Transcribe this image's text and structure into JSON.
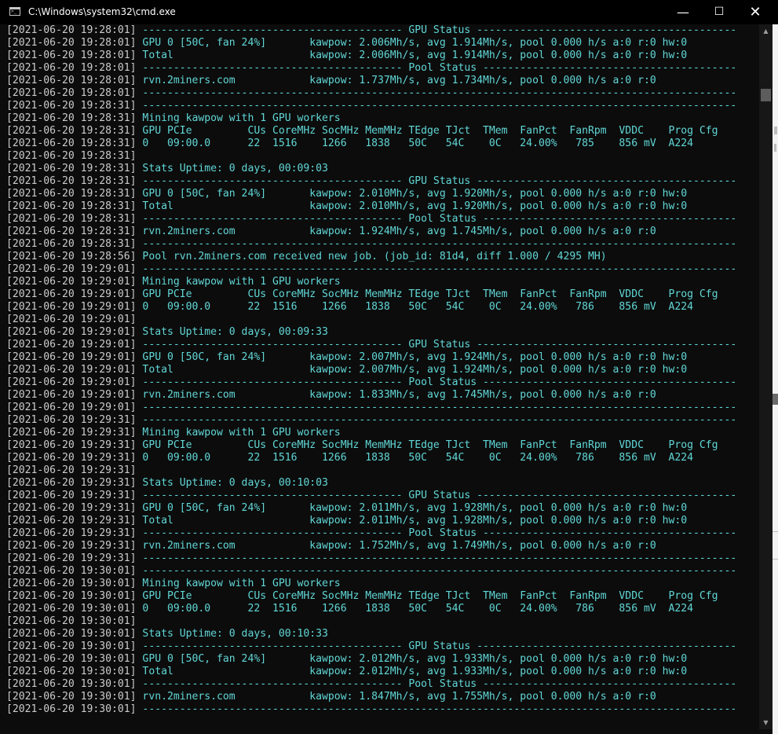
{
  "window": {
    "title": "C:\\Windows\\system32\\cmd.exe",
    "buttons": {
      "minimize": "—",
      "maximize": "☐",
      "close": "✕"
    }
  },
  "console": {
    "lines": [
      {
        "ts": "[2021-06-20 19:28:01]",
        "msg": " ------------------------------------------ GPU Status ------------------------------------------"
      },
      {
        "ts": "[2021-06-20 19:28:01]",
        "msg": " GPU 0 [50C, fan 24%]       kawpow: 2.006Mh/s, avg 1.914Mh/s, pool 0.000 h/s a:0 r:0 hw:0"
      },
      {
        "ts": "[2021-06-20 19:28:01]",
        "msg": " Total                      kawpow: 2.006Mh/s, avg 1.914Mh/s, pool 0.000 h/s a:0 r:0 hw:0"
      },
      {
        "ts": "[2021-06-20 19:28:01]",
        "msg": " ------------------------------------------ Pool Status -----------------------------------------"
      },
      {
        "ts": "[2021-06-20 19:28:01]",
        "msg": " rvn.2miners.com            kawpow: 1.737Mh/s, avg 1.734Mh/s, pool 0.000 h/s a:0 r:0"
      },
      {
        "ts": "[2021-06-20 19:28:01]",
        "msg": " ------------------------------------------------------------------------------------------------"
      },
      {
        "ts": "[2021-06-20 19:28:31]",
        "msg": " ------------------------------------------------------------------------------------------------"
      },
      {
        "ts": "[2021-06-20 19:28:31]",
        "msg": " Mining kawpow with 1 GPU workers"
      },
      {
        "ts": "[2021-06-20 19:28:31]",
        "msg": " GPU PCIe         CUs CoreMHz SocMHz MemMHz TEdge TJct  TMem  FanPct  FanRpm  VDDC    Prog Cfg"
      },
      {
        "ts": "[2021-06-20 19:28:31]",
        "msg": " 0   09:00.0      22  1516    1266   1838   50C   54C    0C   24.00%   785    856 mV  A224"
      },
      {
        "ts": "[2021-06-20 19:28:31]",
        "msg": ""
      },
      {
        "ts": "[2021-06-20 19:28:31]",
        "msg": " Stats Uptime: 0 days, 00:09:03"
      },
      {
        "ts": "[2021-06-20 19:28:31]",
        "msg": " ------------------------------------------ GPU Status ------------------------------------------"
      },
      {
        "ts": "[2021-06-20 19:28:31]",
        "msg": " GPU 0 [50C, fan 24%]       kawpow: 2.010Mh/s, avg 1.920Mh/s, pool 0.000 h/s a:0 r:0 hw:0"
      },
      {
        "ts": "[2021-06-20 19:28:31]",
        "msg": " Total                      kawpow: 2.010Mh/s, avg 1.920Mh/s, pool 0.000 h/s a:0 r:0 hw:0"
      },
      {
        "ts": "[2021-06-20 19:28:31]",
        "msg": " ------------------------------------------ Pool Status -----------------------------------------"
      },
      {
        "ts": "[2021-06-20 19:28:31]",
        "msg": " rvn.2miners.com            kawpow: 1.924Mh/s, avg 1.745Mh/s, pool 0.000 h/s a:0 r:0"
      },
      {
        "ts": "[2021-06-20 19:28:31]",
        "msg": " ------------------------------------------------------------------------------------------------"
      },
      {
        "ts": "[2021-06-20 19:28:56]",
        "msg": " Pool rvn.2miners.com received new job. (job_id: 81d4, diff 1.000 / 4295 MH)"
      },
      {
        "ts": "[2021-06-20 19:29:01]",
        "msg": " ------------------------------------------------------------------------------------------------"
      },
      {
        "ts": "[2021-06-20 19:29:01]",
        "msg": " Mining kawpow with 1 GPU workers"
      },
      {
        "ts": "[2021-06-20 19:29:01]",
        "msg": " GPU PCIe         CUs CoreMHz SocMHz MemMHz TEdge TJct  TMem  FanPct  FanRpm  VDDC    Prog Cfg"
      },
      {
        "ts": "[2021-06-20 19:29:01]",
        "msg": " 0   09:00.0      22  1516    1266   1838   50C   54C    0C   24.00%   786    856 mV  A224"
      },
      {
        "ts": "[2021-06-20 19:29:01]",
        "msg": ""
      },
      {
        "ts": "[2021-06-20 19:29:01]",
        "msg": " Stats Uptime: 0 days, 00:09:33"
      },
      {
        "ts": "[2021-06-20 19:29:01]",
        "msg": " ------------------------------------------ GPU Status ------------------------------------------"
      },
      {
        "ts": "[2021-06-20 19:29:01]",
        "msg": " GPU 0 [50C, fan 24%]       kawpow: 2.007Mh/s, avg 1.924Mh/s, pool 0.000 h/s a:0 r:0 hw:0"
      },
      {
        "ts": "[2021-06-20 19:29:01]",
        "msg": " Total                      kawpow: 2.007Mh/s, avg 1.924Mh/s, pool 0.000 h/s a:0 r:0 hw:0"
      },
      {
        "ts": "[2021-06-20 19:29:01]",
        "msg": " ------------------------------------------ Pool Status -----------------------------------------"
      },
      {
        "ts": "[2021-06-20 19:29:01]",
        "msg": " rvn.2miners.com            kawpow: 1.833Mh/s, avg 1.745Mh/s, pool 0.000 h/s a:0 r:0"
      },
      {
        "ts": "[2021-06-20 19:29:01]",
        "msg": " ------------------------------------------------------------------------------------------------"
      },
      {
        "ts": "[2021-06-20 19:29:31]",
        "msg": " ------------------------------------------------------------------------------------------------"
      },
      {
        "ts": "[2021-06-20 19:29:31]",
        "msg": " Mining kawpow with 1 GPU workers"
      },
      {
        "ts": "[2021-06-20 19:29:31]",
        "msg": " GPU PCIe         CUs CoreMHz SocMHz MemMHz TEdge TJct  TMem  FanPct  FanRpm  VDDC    Prog Cfg"
      },
      {
        "ts": "[2021-06-20 19:29:31]",
        "msg": " 0   09:00.0      22  1516    1266   1838   50C   54C    0C   24.00%   786    856 mV  A224"
      },
      {
        "ts": "[2021-06-20 19:29:31]",
        "msg": ""
      },
      {
        "ts": "[2021-06-20 19:29:31]",
        "msg": " Stats Uptime: 0 days, 00:10:03"
      },
      {
        "ts": "[2021-06-20 19:29:31]",
        "msg": " ------------------------------------------ GPU Status ------------------------------------------"
      },
      {
        "ts": "[2021-06-20 19:29:31]",
        "msg": " GPU 0 [50C, fan 24%]       kawpow: 2.011Mh/s, avg 1.928Mh/s, pool 0.000 h/s a:0 r:0 hw:0"
      },
      {
        "ts": "[2021-06-20 19:29:31]",
        "msg": " Total                      kawpow: 2.011Mh/s, avg 1.928Mh/s, pool 0.000 h/s a:0 r:0 hw:0"
      },
      {
        "ts": "[2021-06-20 19:29:31]",
        "msg": " ------------------------------------------ Pool Status -----------------------------------------"
      },
      {
        "ts": "[2021-06-20 19:29:31]",
        "msg": " rvn.2miners.com            kawpow: 1.752Mh/s, avg 1.749Mh/s, pool 0.000 h/s a:0 r:0"
      },
      {
        "ts": "[2021-06-20 19:29:31]",
        "msg": " ------------------------------------------------------------------------------------------------"
      },
      {
        "ts": "[2021-06-20 19:30:01]",
        "msg": " ------------------------------------------------------------------------------------------------"
      },
      {
        "ts": "[2021-06-20 19:30:01]",
        "msg": " Mining kawpow with 1 GPU workers"
      },
      {
        "ts": "[2021-06-20 19:30:01]",
        "msg": " GPU PCIe         CUs CoreMHz SocMHz MemMHz TEdge TJct  TMem  FanPct  FanRpm  VDDC    Prog Cfg"
      },
      {
        "ts": "[2021-06-20 19:30:01]",
        "msg": " 0   09:00.0      22  1516    1266   1838   50C   54C    0C   24.00%   786    856 mV  A224"
      },
      {
        "ts": "[2021-06-20 19:30:01]",
        "msg": ""
      },
      {
        "ts": "[2021-06-20 19:30:01]",
        "msg": " Stats Uptime: 0 days, 00:10:33"
      },
      {
        "ts": "[2021-06-20 19:30:01]",
        "msg": " ------------------------------------------ GPU Status ------------------------------------------"
      },
      {
        "ts": "[2021-06-20 19:30:01]",
        "msg": " GPU 0 [50C, fan 24%]       kawpow: 2.012Mh/s, avg 1.933Mh/s, pool 0.000 h/s a:0 r:0 hw:0"
      },
      {
        "ts": "[2021-06-20 19:30:01]",
        "msg": " Total                      kawpow: 2.012Mh/s, avg 1.933Mh/s, pool 0.000 h/s a:0 r:0 hw:0"
      },
      {
        "ts": "[2021-06-20 19:30:01]",
        "msg": " ------------------------------------------ Pool Status -----------------------------------------"
      },
      {
        "ts": "[2021-06-20 19:30:01]",
        "msg": " rvn.2miners.com            kawpow: 1.847Mh/s, avg 1.755Mh/s, pool 0.000 h/s a:0 r:0"
      },
      {
        "ts": "[2021-06-20 19:30:01]",
        "msg": " ------------------------------------------------------------------------------------------------"
      }
    ]
  },
  "colors": {
    "console_background": "#0c0c0c",
    "timestamp_text": "#cccccc",
    "message_text": "#61d6d6",
    "titlebar_background": "#000000"
  },
  "scrollbar": {
    "up_arrow": "▲",
    "down_arrow": "▼"
  }
}
